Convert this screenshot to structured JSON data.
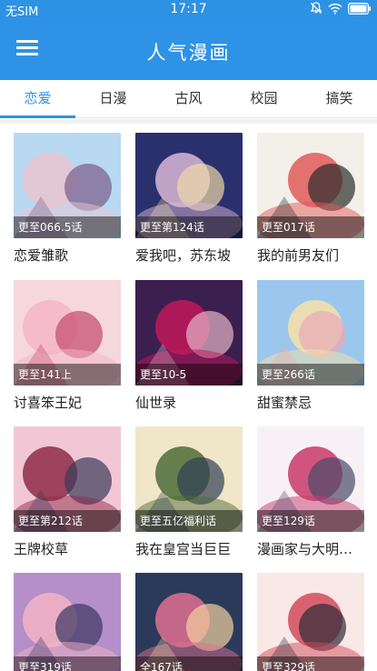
{
  "status_bar": {
    "carrier": "无SIM",
    "time": "17:17",
    "icons": [
      "mute-icon",
      "wifi-icon",
      "battery-icon"
    ]
  },
  "app_bar": {
    "title": "人气漫画",
    "menu_icon": "hamburger-menu-icon"
  },
  "tabs": [
    {
      "label": "恋爱",
      "active": true
    },
    {
      "label": "日漫",
      "active": false
    },
    {
      "label": "古风",
      "active": false
    },
    {
      "label": "校园",
      "active": false
    },
    {
      "label": "搞笑",
      "active": false
    }
  ],
  "colors": {
    "primary": "#2e93e6",
    "text": "#222222",
    "badge_bg": "rgba(0,0,0,0.45)"
  },
  "comics": [
    {
      "title": "恋爱雏歌",
      "status": "更至066.5话",
      "cover_colors": [
        "#b9d8f2",
        "#e9c6cf",
        "#7a5c8a"
      ]
    },
    {
      "title": "爱我吧，苏东坡",
      "status": "更至第124话",
      "cover_colors": [
        "#2a2f6e",
        "#d9b7d6",
        "#f0d9a8"
      ]
    },
    {
      "title": "我的前男友们",
      "status": "更至017话",
      "cover_colors": [
        "#f2f0e8",
        "#e05a5a",
        "#2c2c2c"
      ]
    },
    {
      "title": "讨喜笨王妃",
      "status": "更至141上",
      "cover_colors": [
        "#f6d7dc",
        "#f4b6c7",
        "#c44a6a"
      ]
    },
    {
      "title": "仙世录",
      "status": "更至10-5",
      "cover_colors": [
        "#3b1f4f",
        "#c2185b",
        "#e6b3c8"
      ]
    },
    {
      "title": "甜蜜禁忌",
      "status": "更至266话",
      "cover_colors": [
        "#9bc7ee",
        "#f7e1a6",
        "#e8a9b8"
      ]
    },
    {
      "title": "王牌校草",
      "status": "更至第212话",
      "cover_colors": [
        "#f2c7d5",
        "#8e2a4a",
        "#3a3a5a"
      ]
    },
    {
      "title": "我在皇宫当巨巨",
      "status": "更至五亿福利话",
      "cover_colors": [
        "#f0e6c8",
        "#4f6b3a",
        "#2f3f52"
      ]
    },
    {
      "title": "漫画家与大明…",
      "status": "更至129话",
      "cover_colors": [
        "#f7f1f6",
        "#c83a6a",
        "#4a4a6a"
      ]
    },
    {
      "title": "",
      "status": "更至319话",
      "cover_colors": [
        "#b48fc9",
        "#f2b4c6",
        "#3a3560"
      ]
    },
    {
      "title": "",
      "status": "全167话",
      "cover_colors": [
        "#2b3a5a",
        "#e07090",
        "#f2d0a0"
      ]
    },
    {
      "title": "",
      "status": "更至329话",
      "cover_colors": [
        "#f8e8e6",
        "#d24a5a",
        "#2c2c36"
      ]
    }
  ]
}
